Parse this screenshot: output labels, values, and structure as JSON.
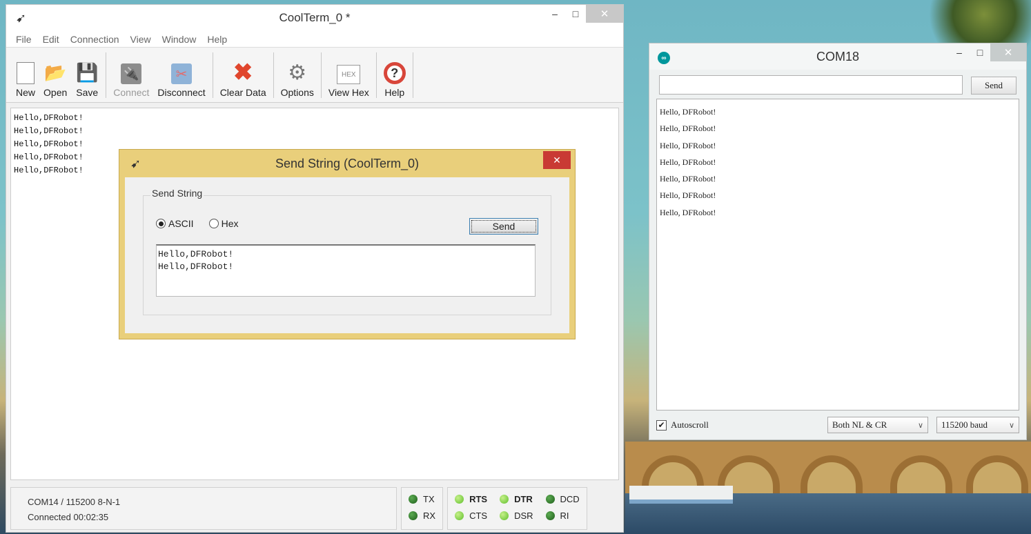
{
  "coolterm": {
    "title": "CoolTerm_0 *",
    "window_controls": {
      "minimize": "–",
      "maximize": "□",
      "close": "✕"
    },
    "menu": [
      "File",
      "Edit",
      "Connection",
      "View",
      "Window",
      "Help"
    ],
    "toolbar": {
      "new": "New",
      "open": "Open",
      "save": "Save",
      "connect": "Connect",
      "disconnect": "Disconnect",
      "clear_data": "Clear Data",
      "options": "Options",
      "view_hex": "View Hex",
      "help": "Help",
      "hex_icon_text": "HEX"
    },
    "terminal_lines": [
      "Hello,DFRobot!",
      "Hello,DFRobot!",
      "Hello,DFRobot!",
      "Hello,DFRobot!",
      "Hello,DFRobot!"
    ],
    "status": {
      "port": "COM14 / 115200 8-N-1",
      "connection": "Connected 00:02:35"
    },
    "leds": {
      "tx": "TX",
      "rx": "RX",
      "rts": "RTS",
      "cts": "CTS",
      "dtr": "DTR",
      "dsr": "DSR",
      "dcd": "DCD",
      "ri": "RI"
    }
  },
  "send_dialog": {
    "title": "Send String (CoolTerm_0)",
    "close": "✕",
    "group_label": "Send String",
    "radio_ascii": "ASCII",
    "radio_hex": "Hex",
    "selected": "ASCII",
    "send_button": "Send",
    "text": "Hello,DFRobot!\nHello,DFRobot!"
  },
  "com18": {
    "title": "COM18",
    "icon_text": "∞",
    "window_controls": {
      "minimize": "–",
      "maximize": "□",
      "close": "✕"
    },
    "input_value": "",
    "send_button": "Send",
    "output_lines": [
      "Hello, DFRobot!",
      "Hello, DFRobot!",
      "Hello, DFRobot!",
      "Hello, DFRobot!",
      "Hello, DFRobot!",
      "Hello, DFRobot!",
      "Hello, DFRobot!"
    ],
    "autoscroll_label": "Autoscroll",
    "autoscroll_checked": true,
    "line_ending": "Both NL & CR",
    "baud": "115200 baud"
  }
}
